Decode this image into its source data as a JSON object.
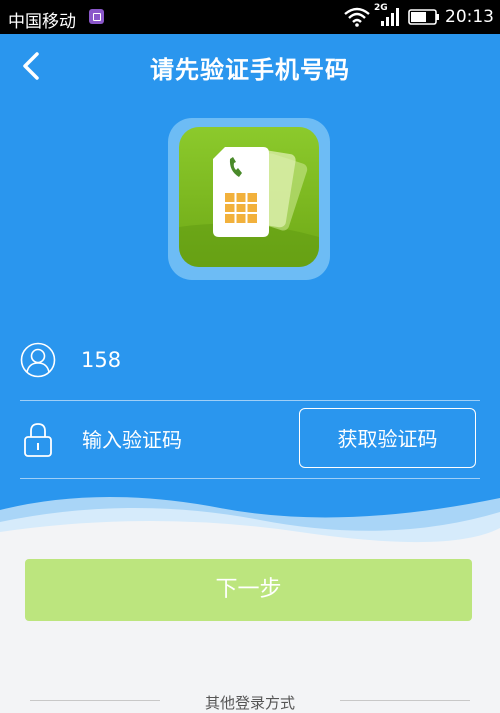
{
  "status_bar": {
    "carrier": "中国移动",
    "network_type": "2G",
    "time": "20:13"
  },
  "header": {
    "title": "请先验证手机号码",
    "back_icon": "chevron-left-icon"
  },
  "app_icon": {
    "name": "sim-card-phone-icon",
    "accent": "#7cbf22"
  },
  "form": {
    "phone_value": "158",
    "code_placeholder": "输入验证码",
    "get_code_label": "获取验证码"
  },
  "actions": {
    "next_label": "下一步",
    "other_login_label": "其他登录方式"
  },
  "colors": {
    "primary": "#2a96ee",
    "next_button": "#bce57e"
  }
}
